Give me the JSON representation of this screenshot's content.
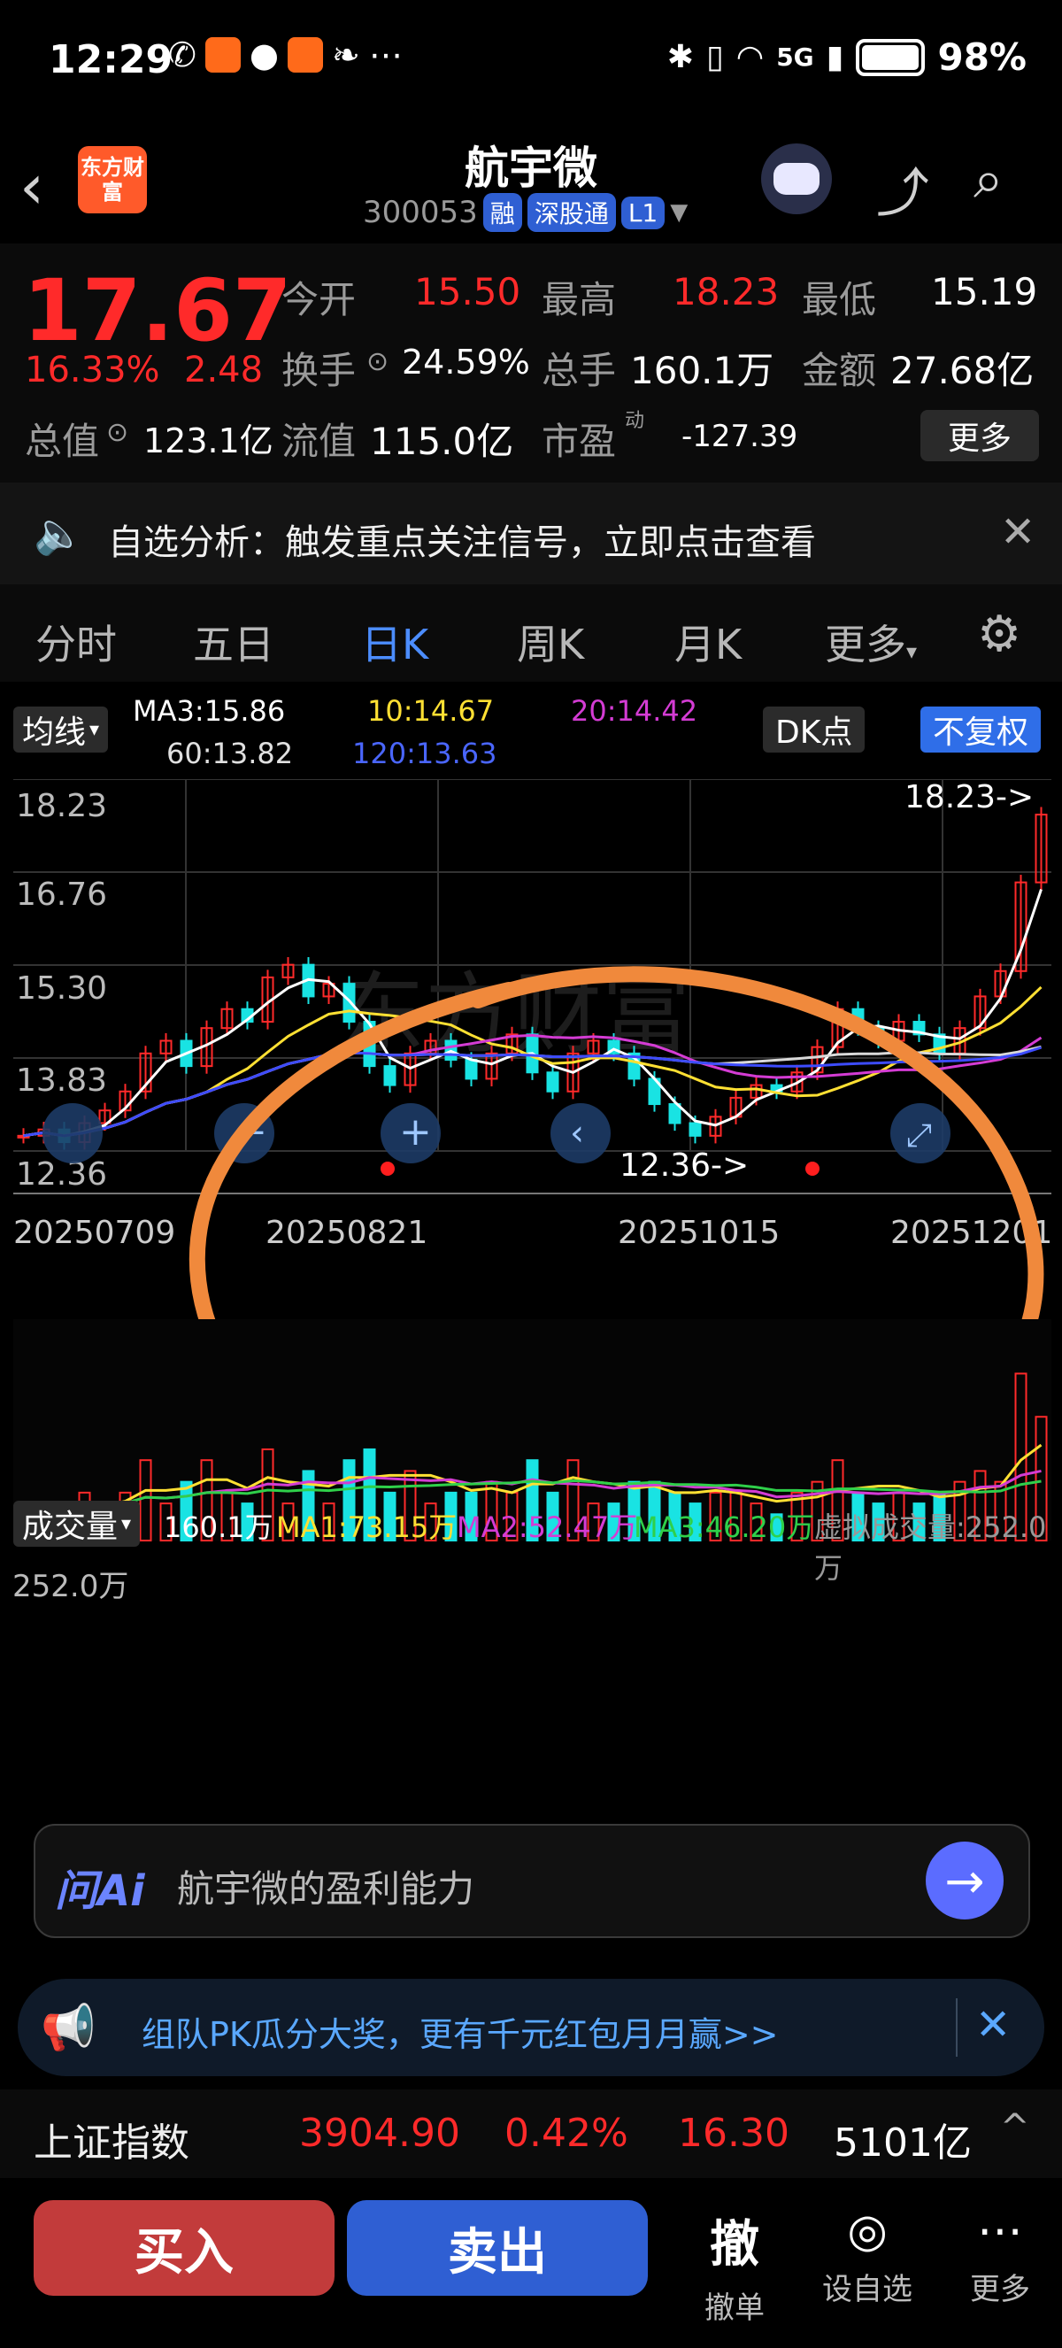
{
  "status": {
    "time": "12:29",
    "battery": "98%",
    "signal_label": "5G",
    "icons": [
      "missed-call-icon",
      "app-badge-icon",
      "wechat-icon",
      "app-person-icon",
      "feather-icon",
      "more-dots-icon",
      "bluetooth-icon",
      "vibrate-icon",
      "wifi-icon",
      "signal-icon",
      "battery-icon"
    ]
  },
  "header": {
    "brand_logo_text": "东方财富",
    "title": "航宇微",
    "code": "300053",
    "tags": [
      "融",
      "深股通",
      "L1"
    ],
    "accent": "#ff5a2a"
  },
  "quote": {
    "price": "17.67",
    "change_pct": "16.33%",
    "change_val": "2.48",
    "fields": {
      "open_label": "今开",
      "open": "15.50",
      "high_label": "最高",
      "high": "18.23",
      "low_label": "最低",
      "low": "15.19",
      "turnover_label": "换手",
      "turnover": "24.59%",
      "volume_label": "总手",
      "volume": "160.1万",
      "amount_label": "金额",
      "amount": "27.68亿",
      "mktcap_label": "总值",
      "mktcap": "123.1亿",
      "float_label": "流值",
      "float": "115.0亿",
      "pe_label": "市盈",
      "pe_sup": "动",
      "pe": "-127.39",
      "more_label": "更多"
    }
  },
  "notice": {
    "text": "自选分析：触发重点关注信号，立即点击查看"
  },
  "tabs": {
    "items": [
      "分时",
      "五日",
      "日K",
      "周K",
      "月K",
      "更多"
    ],
    "active_index": 2
  },
  "kchart": {
    "ma_selector": "均线",
    "ma3": "MA3:15.86",
    "ma10": "10:14.67",
    "ma20": "20:14.42",
    "ma60": "60:13.82",
    "ma120": "120:13.63",
    "dk_label": "DK点",
    "adjust_label": "不复权",
    "y_ticks": [
      "18.23",
      "16.76",
      "15.30",
      "13.83",
      "12.36"
    ],
    "max_label": "18.23->",
    "min_label": "12.36->",
    "x_ticks": [
      "20250709",
      "20250821",
      "20251015",
      "20251201"
    ],
    "watermark": "东方财富"
  },
  "volume": {
    "selector": "成交量",
    "value": "160.1万",
    "ma1": "MA1:73.15万",
    "ma2": "MA2:52.47万",
    "ma3": "MA3:46.20万",
    "virtual": "虚拟成交量:252.0万",
    "y_max": "252.0万"
  },
  "chart_data": {
    "type": "candlestick",
    "title": "",
    "xlabel": "",
    "ylabel": "",
    "ylim": [
      12.36,
      18.23
    ],
    "x_ticks": [
      "20250709",
      "20250821",
      "20251015",
      "20251201"
    ],
    "series_ma": {
      "MA3": 15.86,
      "MA10": 14.67,
      "MA20": 14.42,
      "MA60": 13.82,
      "MA120": 13.63
    },
    "close_series": [
      12.6,
      12.7,
      12.5,
      12.8,
      13.0,
      13.3,
      13.9,
      14.1,
      13.7,
      14.3,
      14.6,
      14.4,
      15.1,
      15.3,
      14.8,
      15.0,
      14.4,
      13.7,
      13.4,
      13.9,
      14.1,
      13.8,
      13.5,
      13.9,
      14.2,
      13.6,
      13.3,
      13.9,
      14.1,
      13.9,
      13.5,
      13.1,
      12.8,
      12.6,
      12.9,
      13.2,
      13.4,
      13.3,
      13.6,
      14.0,
      14.6,
      14.3,
      14.1,
      14.4,
      14.2,
      13.9,
      14.3,
      14.8,
      15.2,
      16.6,
      17.67
    ],
    "volume_max": 252.0,
    "volume_current": 160.1
  },
  "ai": {
    "brand": "问Ai",
    "prompt": "航宇微的盈利能力"
  },
  "promo": {
    "text": "组队PK瓜分大奖，更有千元红包月月赢>>"
  },
  "index_bar": {
    "name": "上证指数",
    "value": "3904.90",
    "pct": "0.42%",
    "change": "16.30",
    "amount": "5101亿"
  },
  "bottom": {
    "buy": "买入",
    "sell": "卖出",
    "cancel_big": "撤",
    "cancel": "撤单",
    "watch": "设自选",
    "more": "更多"
  }
}
